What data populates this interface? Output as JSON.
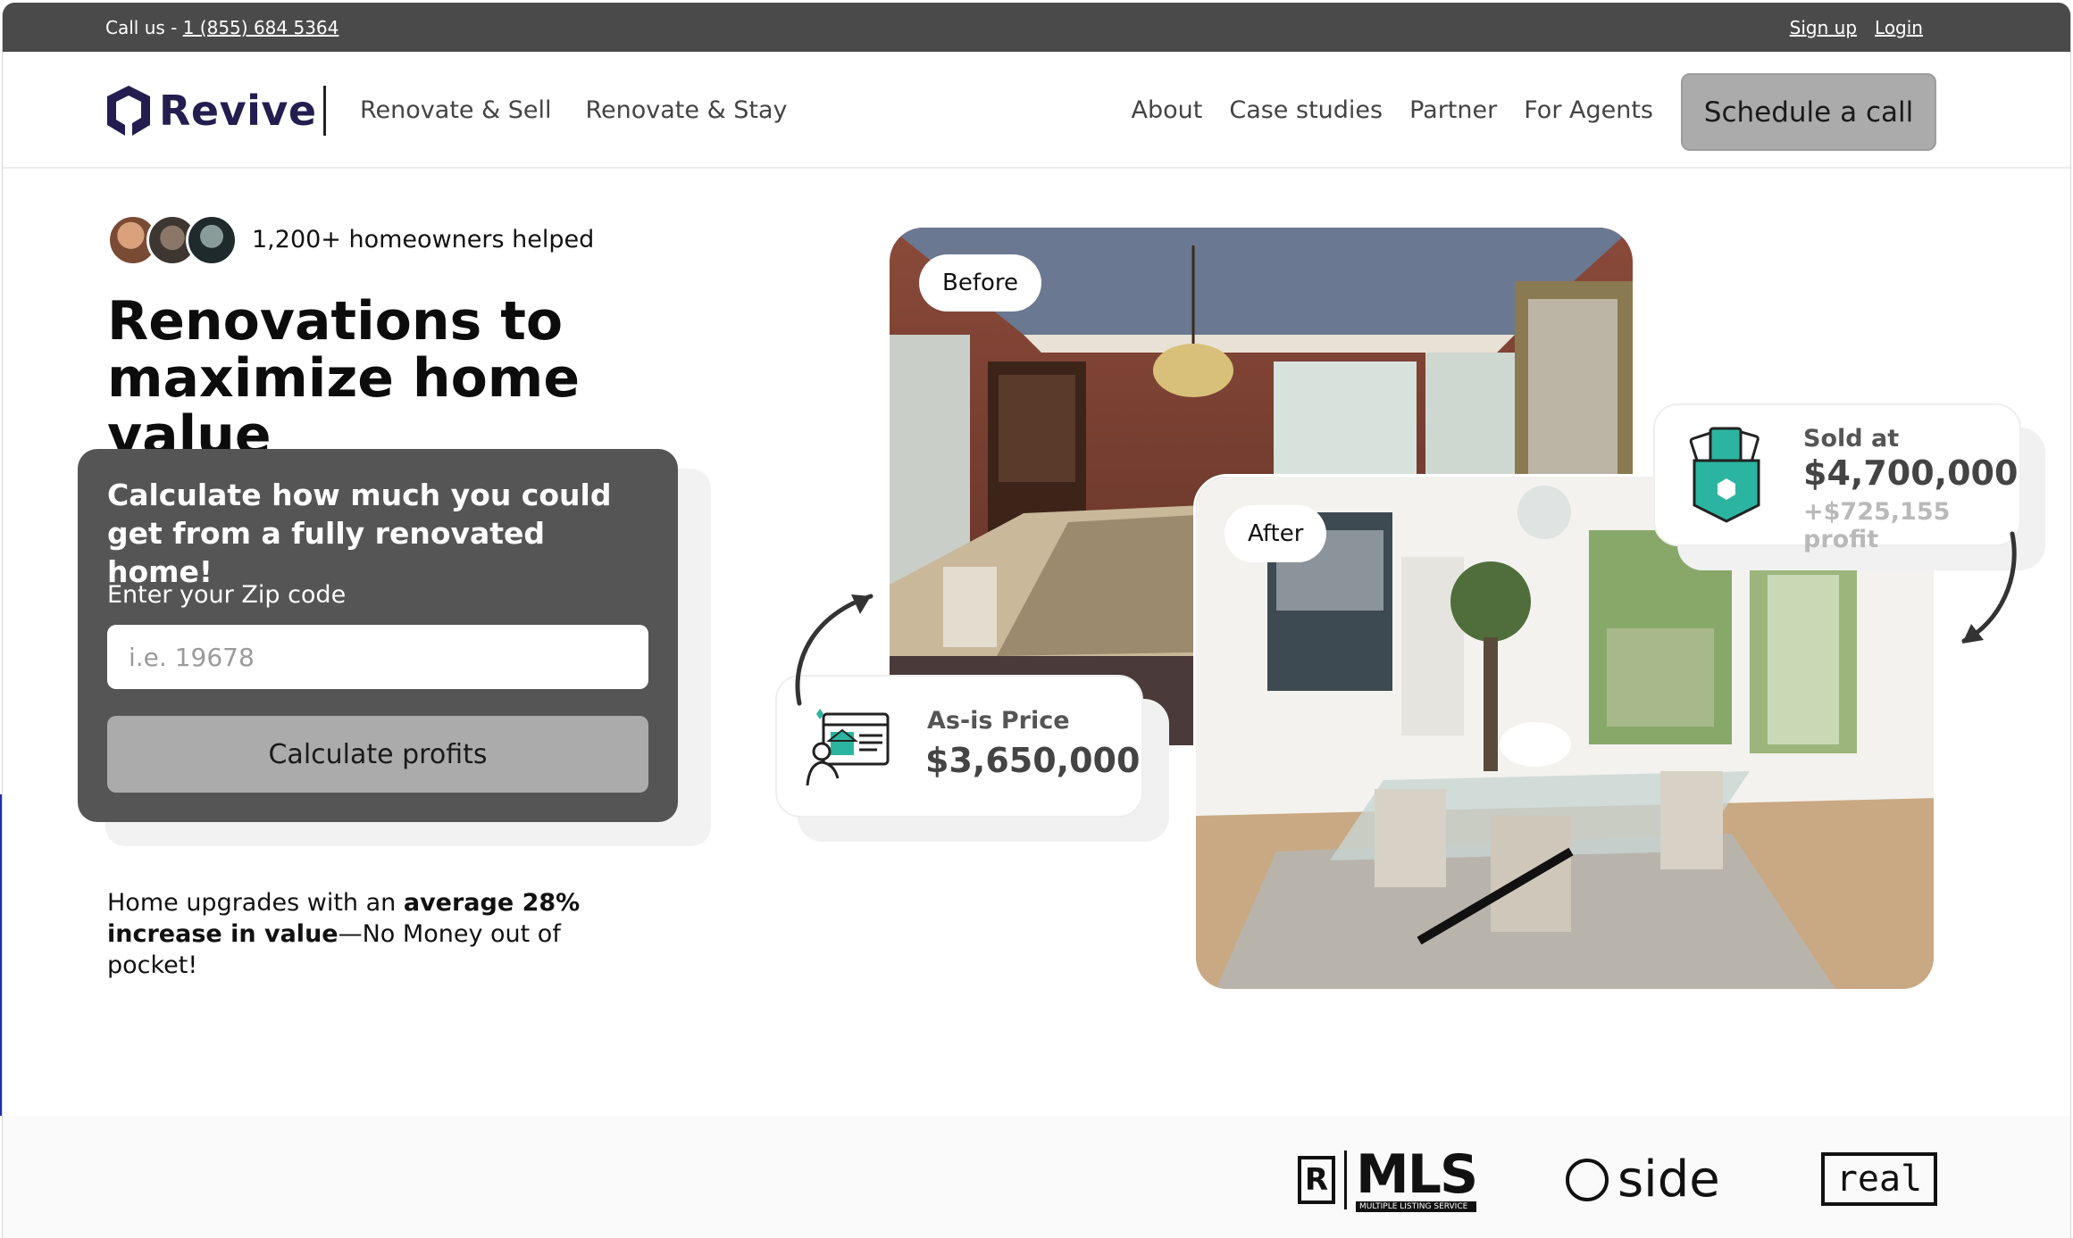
{
  "topbar": {
    "call_prefix": "Call us - ",
    "phone": "1 (855) 684 5364",
    "signup": "Sign up",
    "login": "Login"
  },
  "nav": {
    "brand": "Revive",
    "left_items": [
      "Renovate & Sell",
      "Renovate & Stay"
    ],
    "right_items": [
      "About",
      "Case studies",
      "Partner",
      "For Agents"
    ],
    "cta": "Schedule a call"
  },
  "hero": {
    "social_proof": "1,200+ homeowners helped",
    "headline_line1": "Renovations to",
    "headline_line2": "maximize home value",
    "calc_title": "Calculate how much you could get from a fully renovated home!",
    "zip_label": "Enter your Zip code",
    "zip_placeholder": "i.e. 19678",
    "calc_button": "Calculate profits",
    "upgrade_prefix": "Home upgrades with an ",
    "upgrade_bold": "average 28% increase in value",
    "upgrade_suffix": "—No Money out of pocket!"
  },
  "visual": {
    "before_label": "Before",
    "after_label": "After",
    "asis_label": "As-is Price",
    "asis_value": "$3,650,000",
    "sold_label": "Sold at",
    "sold_value": "$4,700,000",
    "sold_profit": "+$725,155 profit"
  },
  "partners": {
    "mls_text": "MLS",
    "mls_sub": "MULTIPLE LISTING SERVICE",
    "realtor_mark": "R",
    "side_text": "side",
    "real_text": "real"
  },
  "colors": {
    "topbar": "#4a4a4a",
    "brand_navy": "#231e4f",
    "cta_gray": "#ababab",
    "calc_bg": "#555555",
    "teal_accent": "#2bb5a0"
  }
}
